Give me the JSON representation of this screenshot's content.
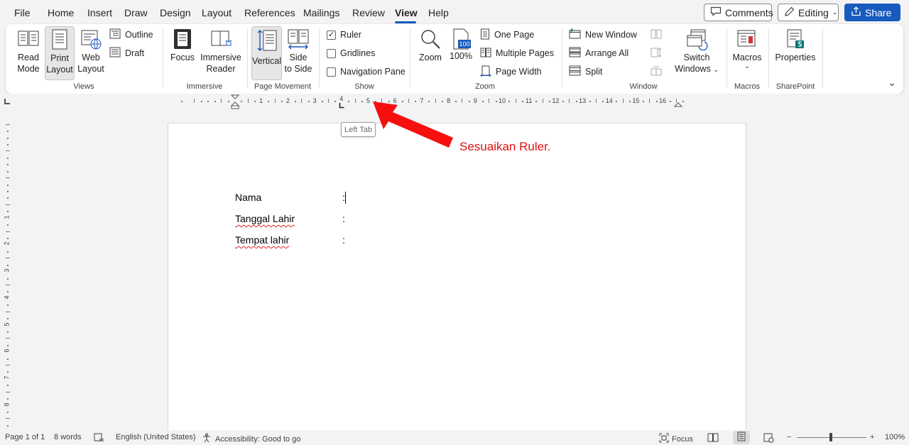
{
  "menu": {
    "items": [
      "File",
      "Home",
      "Insert",
      "Draw",
      "Design",
      "Layout",
      "References",
      "Mailings",
      "Review",
      "View",
      "Help"
    ],
    "active": "View"
  },
  "top_buttons": {
    "comments": "Comments",
    "editing": "Editing",
    "share": "Share"
  },
  "ribbon": {
    "views": {
      "label": "Views",
      "read_mode": [
        "Read",
        "Mode"
      ],
      "print_layout": [
        "Print",
        "Layout"
      ],
      "web_layout": [
        "Web",
        "Layout"
      ],
      "outline": "Outline",
      "draft": "Draft"
    },
    "immersive": {
      "label": "Immersive",
      "focus": "Focus",
      "immersive_reader": [
        "Immersive",
        "Reader"
      ]
    },
    "page_movement": {
      "label": "Page Movement",
      "vertical": "Vertical",
      "side_to_side": [
        "Side",
        "to Side"
      ]
    },
    "show": {
      "label": "Show",
      "ruler": {
        "text": "Ruler",
        "checked": true
      },
      "gridlines": {
        "text": "Gridlines",
        "checked": false
      },
      "navigation_pane": {
        "text": "Navigation Pane",
        "checked": false
      }
    },
    "zoom": {
      "label": "Zoom",
      "zoom": "Zoom",
      "hundred_badge": "100",
      "percent": "100%",
      "one_page": "One Page",
      "multiple_pages": "Multiple Pages",
      "page_width": "Page Width"
    },
    "window": {
      "label": "Window",
      "new_window": "New Window",
      "arrange_all": "Arrange All",
      "split": "Split",
      "switch_windows": [
        "Switch",
        "Windows"
      ]
    },
    "macros": {
      "label": "Macros",
      "macros": "Macros"
    },
    "sharepoint": {
      "label": "SharePoint",
      "properties": "Properties"
    }
  },
  "ruler": {
    "numbers": [
      "1",
      "2",
      "3",
      "4",
      "5",
      "6",
      "7",
      "8",
      "9",
      "10",
      "11",
      "12",
      "13",
      "14",
      "15",
      "16"
    ],
    "vertical_numbers": [
      "1",
      "2",
      "3",
      "4",
      "5",
      "6",
      "7",
      "8"
    ]
  },
  "tooltip": "Left Tab",
  "annotation": "Sesuaikan Ruler.",
  "document": {
    "lines": [
      {
        "label": "Nama",
        "sep": ":"
      },
      {
        "label": "Tanggal Lahir",
        "sep": ":"
      },
      {
        "label": "Tempat lahir",
        "sep": ":"
      }
    ]
  },
  "status": {
    "page": "Page 1 of 1",
    "words": "8 words",
    "language": "English (United States)",
    "accessibility": "Accessibility: Good to go",
    "focus": "Focus",
    "zoom_level": "100%",
    "zoom_minus": "−",
    "zoom_plus": "+"
  },
  "colors": {
    "accent": "#185abd",
    "annotation": "#e01010"
  }
}
